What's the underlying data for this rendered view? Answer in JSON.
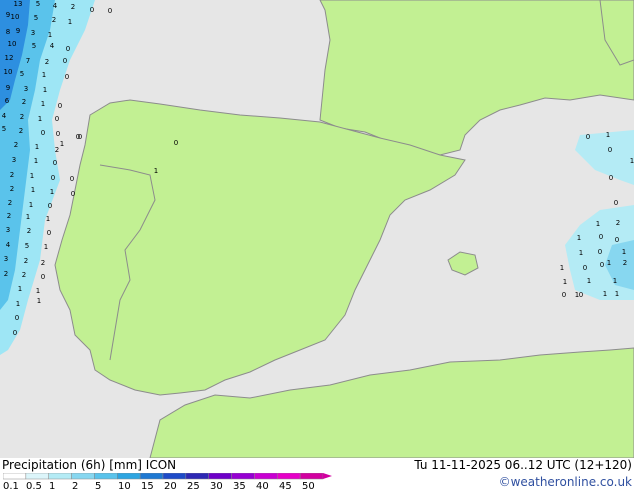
{
  "map": {
    "colors": {
      "sea": "#e6e6e6",
      "land": "#c2f093",
      "border": "#8c8c8c",
      "precip_light": "#9ee6f5",
      "precip_mid": "#3fb4e6",
      "precip_heavy": "#2060e0"
    },
    "value_labels": [
      {
        "v": "13"
      },
      {
        "v": "5"
      },
      {
        "v": "4"
      },
      {
        "v": "2"
      },
      {
        "v": "0"
      },
      {
        "v": "0"
      },
      {
        "v": "9"
      },
      {
        "v": "10"
      },
      {
        "v": "5"
      },
      {
        "v": "2"
      },
      {
        "v": "1"
      },
      {
        "v": "8"
      },
      {
        "v": "9"
      },
      {
        "v": "3"
      },
      {
        "v": "1"
      },
      {
        "v": "10"
      },
      {
        "v": "5"
      },
      {
        "v": "4"
      },
      {
        "v": "0"
      },
      {
        "v": "12"
      },
      {
        "v": "7"
      },
      {
        "v": "2"
      },
      {
        "v": "0"
      },
      {
        "v": "10"
      },
      {
        "v": "5"
      },
      {
        "v": "1"
      },
      {
        "v": "0"
      },
      {
        "v": "9"
      },
      {
        "v": "3"
      },
      {
        "v": "1"
      },
      {
        "v": "6"
      },
      {
        "v": "2"
      },
      {
        "v": "1"
      },
      {
        "v": "0"
      },
      {
        "v": "4"
      },
      {
        "v": "2"
      },
      {
        "v": "1"
      },
      {
        "v": "0"
      },
      {
        "v": "5"
      },
      {
        "v": "2"
      },
      {
        "v": "0"
      },
      {
        "v": "0"
      },
      {
        "v": "0"
      },
      {
        "v": "2"
      },
      {
        "v": "1"
      },
      {
        "v": "2"
      },
      {
        "v": "3"
      },
      {
        "v": "1"
      },
      {
        "v": "0"
      },
      {
        "v": "0"
      },
      {
        "v": "2"
      },
      {
        "v": "1"
      },
      {
        "v": "0"
      },
      {
        "v": "0"
      },
      {
        "v": "2"
      },
      {
        "v": "1"
      },
      {
        "v": "1"
      },
      {
        "v": "2"
      },
      {
        "v": "1"
      },
      {
        "v": "0"
      },
      {
        "v": "2"
      },
      {
        "v": "1"
      },
      {
        "v": "1"
      },
      {
        "v": "3"
      },
      {
        "v": "2"
      },
      {
        "v": "0"
      },
      {
        "v": "4"
      },
      {
        "v": "5"
      },
      {
        "v": "1"
      },
      {
        "v": "3"
      },
      {
        "v": "2"
      },
      {
        "v": "2"
      },
      {
        "v": "2"
      },
      {
        "v": "2"
      },
      {
        "v": "0"
      },
      {
        "v": "1"
      },
      {
        "v": "1"
      },
      {
        "v": "1"
      },
      {
        "v": "1"
      },
      {
        "v": "0"
      },
      {
        "v": "0"
      },
      {
        "v": "0"
      },
      {
        "v": "1"
      },
      {
        "v": "0"
      },
      {
        "v": "1"
      },
      {
        "v": "0"
      },
      {
        "v": "1"
      },
      {
        "v": "0"
      },
      {
        "v": "1"
      },
      {
        "v": "0"
      },
      {
        "v": "0"
      },
      {
        "v": "1"
      },
      {
        "v": "2"
      },
      {
        "v": "1"
      },
      {
        "v": "0"
      },
      {
        "v": "0"
      },
      {
        "v": "1"
      },
      {
        "v": "0"
      },
      {
        "v": "1"
      },
      {
        "v": "1"
      },
      {
        "v": "2"
      },
      {
        "v": "1"
      },
      {
        "v": "0"
      },
      {
        "v": "0"
      },
      {
        "v": "1"
      },
      {
        "v": "1"
      },
      {
        "v": "1"
      },
      {
        "v": "1"
      },
      {
        "v": "0"
      },
      {
        "v": "0"
      },
      {
        "v": "1"
      },
      {
        "v": "1"
      }
    ]
  },
  "legend": {
    "title": "Precipitation (6h) [mm] ICON",
    "datetime": "Tu 11-11-2025 06..12 UTC (12+120)",
    "credit": "©weatheronline.co.uk",
    "ticks": [
      "0.1",
      "0.5",
      "1",
      "2",
      "5",
      "10",
      "15",
      "20",
      "25",
      "30",
      "35",
      "40",
      "45",
      "50"
    ],
    "colors": [
      "#ffffff",
      "#dcf5fa",
      "#b4ebf5",
      "#87d7f0",
      "#5ac3eb",
      "#2da5e1",
      "#1e78d2",
      "#1e4bc8",
      "#2d28b4",
      "#6e00c8",
      "#9600d2",
      "#c800d2",
      "#e600c8",
      "#d200a0"
    ]
  }
}
